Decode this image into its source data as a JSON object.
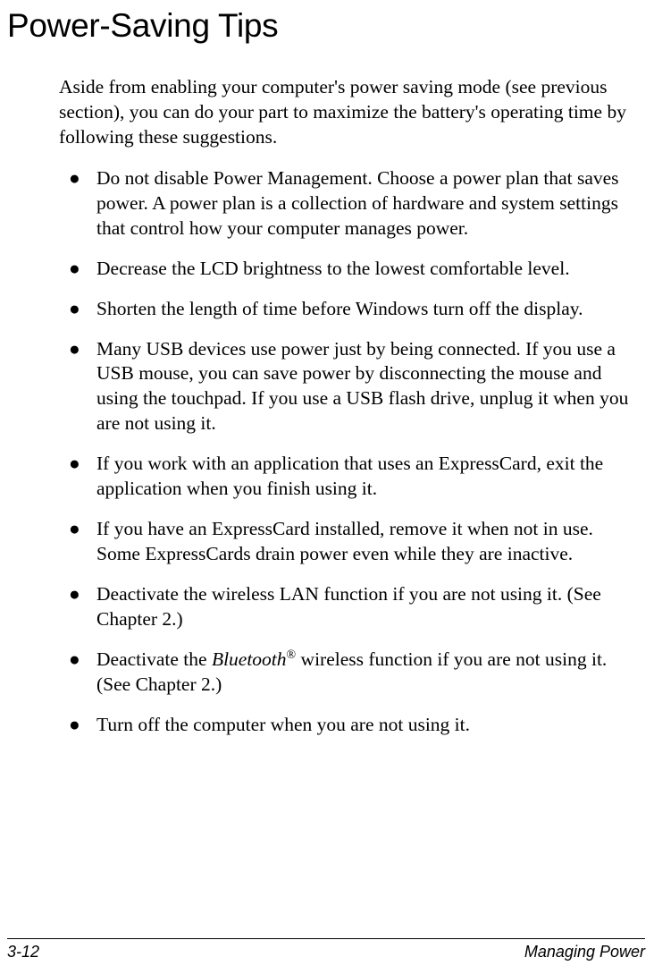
{
  "heading": "Power-Saving Tips",
  "intro": "Aside from enabling your computer's power saving mode (see previous section), you can do your part to maximize the battery's operating time by following these suggestions.",
  "tips": [
    {
      "text_parts": [
        {
          "t": "Do not disable Power Management. Choose a power plan that saves power. A power plan is a collection of hardware and system settings that control how your computer manages power."
        }
      ]
    },
    {
      "text_parts": [
        {
          "t": "Decrease the LCD brightness to the lowest comfortable level."
        }
      ]
    },
    {
      "text_parts": [
        {
          "t": "Shorten the length of time before Windows turn off the display."
        }
      ]
    },
    {
      "text_parts": [
        {
          "t": "Many USB devices use power just by being connected. If you use a USB mouse, you can save power by disconnecting the mouse and using the touchpad. If you use a USB flash drive, unplug it when you are not using it."
        }
      ]
    },
    {
      "text_parts": [
        {
          "t": "If you work with an application that uses an ExpressCard, exit the application when you finish using it."
        }
      ]
    },
    {
      "text_parts": [
        {
          "t": "If you have an ExpressCard installed, remove it when not in use. Some ExpressCards drain power even while they are inactive."
        }
      ]
    },
    {
      "text_parts": [
        {
          "t": "Deactivate the wireless LAN function if you are not using it. (See Chapter 2.)"
        }
      ]
    },
    {
      "text_parts": [
        {
          "t": "Deactivate the "
        },
        {
          "t": "Bluetooth",
          "italic": true
        },
        {
          "t": "®",
          "sup": true
        },
        {
          "t": " wireless function if you are not using it. (See Chapter 2.)"
        }
      ]
    },
    {
      "text_parts": [
        {
          "t": "Turn off the computer when you are not using it."
        }
      ]
    }
  ],
  "bullet_char": "●",
  "footer": {
    "page": "3-12",
    "section": "Managing Power"
  }
}
